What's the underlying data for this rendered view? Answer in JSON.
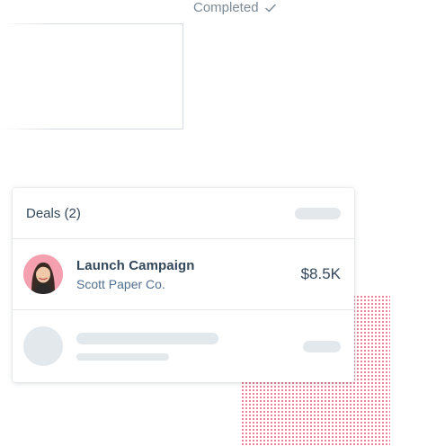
{
  "status": {
    "label": "Completed",
    "icon": "checkmark-icon"
  },
  "deals_card": {
    "title": "Deals (2)",
    "deals": [
      {
        "name": "Launch Campaign",
        "company": "Scott Paper Co.",
        "amount": "$8.5K",
        "avatar_icon": "person-avatar"
      }
    ]
  },
  "colors": {
    "accent_dots": "#e64a6d",
    "text_primary": "#33475b",
    "text_secondary": "#516f90",
    "skeleton": "#e3e8ed",
    "avatar_bg": "#f4a0ae"
  }
}
